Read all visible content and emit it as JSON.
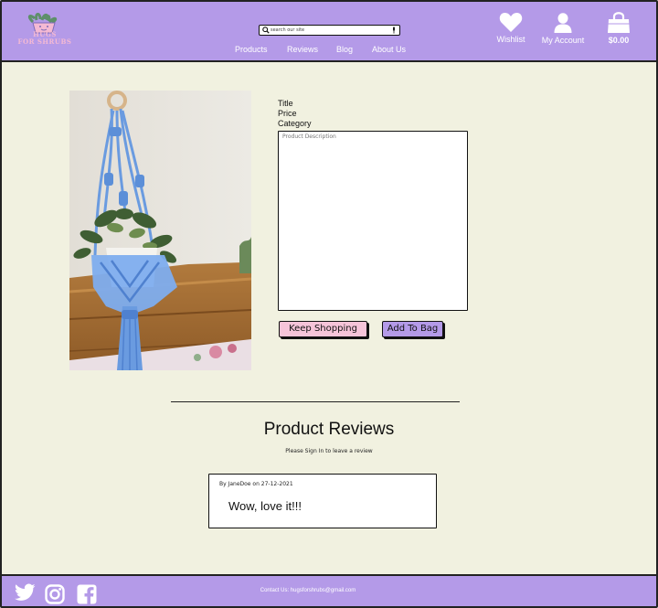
{
  "header": {
    "logo_text_line1": "HUGS",
    "logo_text_line2": "FOR SHRUBS",
    "search_placeholder": "search our site",
    "nav": [
      {
        "label": "Products"
      },
      {
        "label": "Reviews"
      },
      {
        "label": "Blog"
      },
      {
        "label": "About Us"
      }
    ],
    "wishlist_label": "Wishlist",
    "account_label": "My Account",
    "cart_total": "$0.00"
  },
  "product": {
    "title_label": "Title",
    "price_label": "Price",
    "category_label": "Category",
    "description_placeholder": "Product Description",
    "keep_shopping_label": "Keep Shopping",
    "add_to_bag_label": "Add To Bag"
  },
  "reviews": {
    "heading": "Product Reviews",
    "sign_in_note": "Please Sign In to leave a review",
    "items": [
      {
        "byline": "By JaneDoe on 27-12-2021",
        "text": "Wow, love it!!!"
      }
    ]
  },
  "footer": {
    "contact": "Contact Us: hugsforshrubs@gmail.com"
  },
  "colors": {
    "accent": "#b49ae8",
    "background": "#f1f1e0",
    "pink": "#f6c4d9"
  },
  "icons": [
    "search-icon",
    "microphone-icon",
    "heart-icon",
    "user-icon",
    "shopping-bag-icon",
    "twitter-icon",
    "instagram-icon",
    "facebook-icon"
  ]
}
